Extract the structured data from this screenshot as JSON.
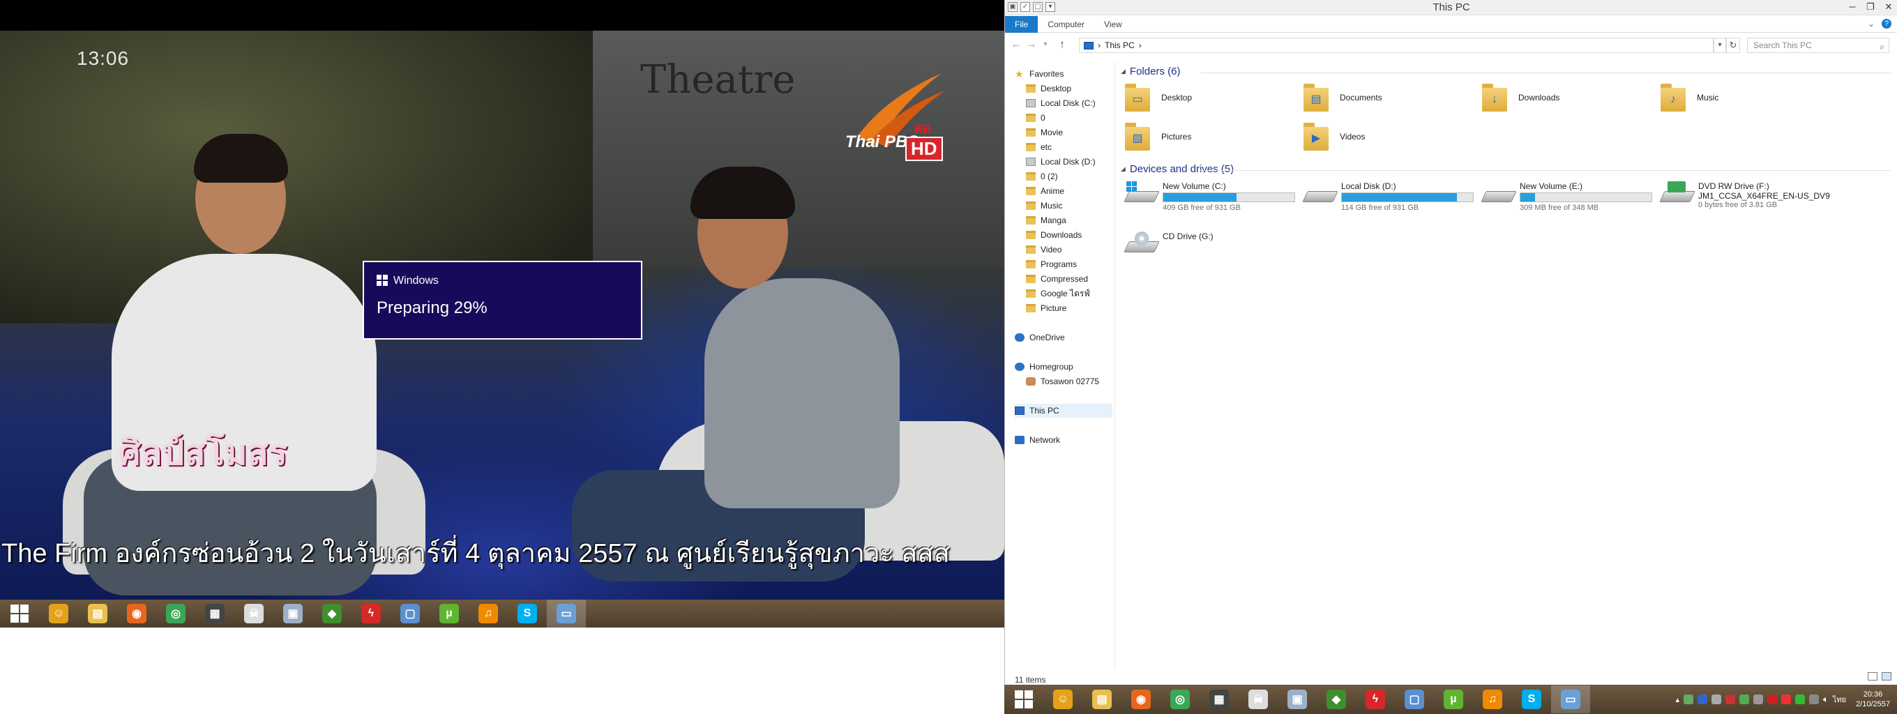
{
  "video": {
    "clock": "13:06",
    "set_text": "Theatre",
    "logo_brand": "Thai PBS",
    "logo_hd": "HD",
    "logo_live": "สด",
    "program_title": "ศิลป์สโมสร",
    "subtitle": "The Firm องค์กรซ่อนอ้วน 2 ในวันเสาร์ที่ 4 ตุลาคม 2557 ณ ศูนย์เรียนรู้สุขภาวะ สสส"
  },
  "toast": {
    "title": "Windows",
    "message": "Preparing 29%",
    "progress_percent": 29
  },
  "taskbar": {
    "apps": [
      {
        "name": "app-1",
        "icon": "cat-face-icon",
        "color": "#e3a21a",
        "glyph": "☺"
      },
      {
        "name": "file-explorer",
        "icon": "folder-icon",
        "color": "#e8c04f",
        "glyph": "▤"
      },
      {
        "name": "firefox",
        "icon": "firefox-icon",
        "color": "#e8661c",
        "glyph": "◉"
      },
      {
        "name": "chrome",
        "icon": "chrome-icon",
        "color": "#3aa757",
        "glyph": "◎"
      },
      {
        "name": "media-player",
        "icon": "clapperboard-icon",
        "color": "#444444",
        "glyph": "▦"
      },
      {
        "name": "app-6",
        "icon": "mask-icon",
        "color": "#dddddd",
        "glyph": "☠"
      },
      {
        "name": "app-7",
        "icon": "computer-icon",
        "color": "#9cb1c8",
        "glyph": "▣"
      },
      {
        "name": "app-8",
        "icon": "globe-icon",
        "color": "#3f8f2f",
        "glyph": "◆"
      },
      {
        "name": "app-9",
        "icon": "lightning-icon",
        "color": "#d72828",
        "glyph": "ϟ"
      },
      {
        "name": "remote-desktop",
        "icon": "monitor-icon",
        "color": "#5a8fd0",
        "glyph": "▢"
      },
      {
        "name": "utorrent",
        "icon": "utorrent-icon",
        "color": "#5fb432",
        "glyph": "µ"
      },
      {
        "name": "music-app",
        "icon": "music-icon",
        "color": "#f08a00",
        "glyph": "♫"
      },
      {
        "name": "skype",
        "icon": "skype-icon",
        "color": "#00aff0",
        "glyph": "S"
      },
      {
        "name": "this-pc",
        "icon": "pc-icon",
        "color": "#6aa0d8",
        "glyph": "▭"
      }
    ]
  },
  "explorer": {
    "title": "This PC",
    "tabs": [
      "File",
      "Computer",
      "View"
    ],
    "address": "This PC",
    "search_placeholder": "Search This PC",
    "nav": {
      "favorites_label": "Favorites",
      "favorites": [
        "Desktop",
        "Local Disk (C:)",
        "0",
        "Movie",
        "etc",
        "Local Disk (D:)",
        "0 (2)",
        "Anime",
        "Music",
        "Manga",
        "Downloads",
        "Video",
        "Programs",
        "Compressed",
        "Google ไดรฟ์",
        "Picture"
      ],
      "onedrive": "OneDrive",
      "homegroup": "Homegroup",
      "homegroup_user": "Tosawon 02775",
      "this_pc": "This PC",
      "network": "Network"
    },
    "folders_header": "Folders (6)",
    "folders": [
      "Desktop",
      "Documents",
      "Downloads",
      "Music",
      "Pictures",
      "Videos"
    ],
    "drives_header": "Devices and drives (5)",
    "drives": [
      {
        "name": "New Volume (C:)",
        "free": "409 GB free of 931 GB",
        "used_fraction": 0.56
      },
      {
        "name": "Local Disk (D:)",
        "free": "114 GB free of 931 GB",
        "used_fraction": 0.88
      },
      {
        "name": "New Volume (E:)",
        "free": "309 MB free of 348 MB",
        "used_fraction": 0.11
      },
      {
        "name": "DVD RW Drive (F:)",
        "label": "JM1_CCSA_X64FRE_EN-US_DV9",
        "free": "0 bytes free of 3.81 GB"
      },
      {
        "name": "CD Drive (G:)"
      }
    ],
    "status": "11 items"
  },
  "tray": {
    "lang": "ไทย",
    "time": "20:36",
    "date": "2/10/2557"
  }
}
